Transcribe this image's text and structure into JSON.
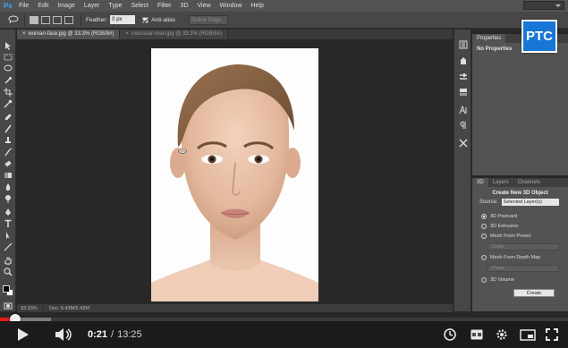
{
  "app": {
    "logo": "Ps",
    "menu": [
      "File",
      "Edit",
      "Image",
      "Layer",
      "Type",
      "Select",
      "Filter",
      "3D",
      "View",
      "Window",
      "Help"
    ]
  },
  "options_bar": {
    "feather_label": "Feather:",
    "feather_value": "0 px",
    "antialias_label": "Anti-alias",
    "refine_edge_label": "Refine Edge..."
  },
  "tabs": [
    {
      "label": "woman-face.jpg @ 33.3% (RGB/8#)",
      "close": "×",
      "active": true
    },
    {
      "label": "muscular-man.jpg @ 33.3% (RGB/8#)",
      "close": "×",
      "active": false
    }
  ],
  "status": {
    "zoom": "33.33%",
    "doc": "Doc: 5.43M/5.43M"
  },
  "properties": {
    "tabs": [
      "Properties"
    ],
    "body": "No Properties"
  },
  "badge": {
    "text": "PTC"
  },
  "panel3d": {
    "tabs": [
      "3D",
      "Layers",
      "Channels"
    ],
    "title": "Create New 3D Object",
    "source_label": "Source:",
    "source_value": "Selected Layer(s)",
    "options": [
      {
        "label": "3D Postcard",
        "selected": true
      },
      {
        "label": "3D Extrusion",
        "selected": false
      },
      {
        "label": "Mesh From Preset",
        "selected": false
      },
      {
        "label": "Mesh From Depth Map",
        "selected": false
      },
      {
        "label": "3D Volume",
        "selected": false
      }
    ],
    "preset_value": "Cube",
    "depth_value": "Plane",
    "create_label": "Create"
  },
  "player": {
    "current_time": "0:21",
    "separator": "/",
    "total_time": "13:25",
    "progress": 0.026,
    "loaded": 0.09,
    "icons": [
      "play-icon",
      "volume-icon",
      "clock-icon",
      "captions-icon",
      "settings-icon",
      "miniplayer-icon",
      "fullscreen-icon"
    ],
    "accent": "#e21c1c"
  }
}
